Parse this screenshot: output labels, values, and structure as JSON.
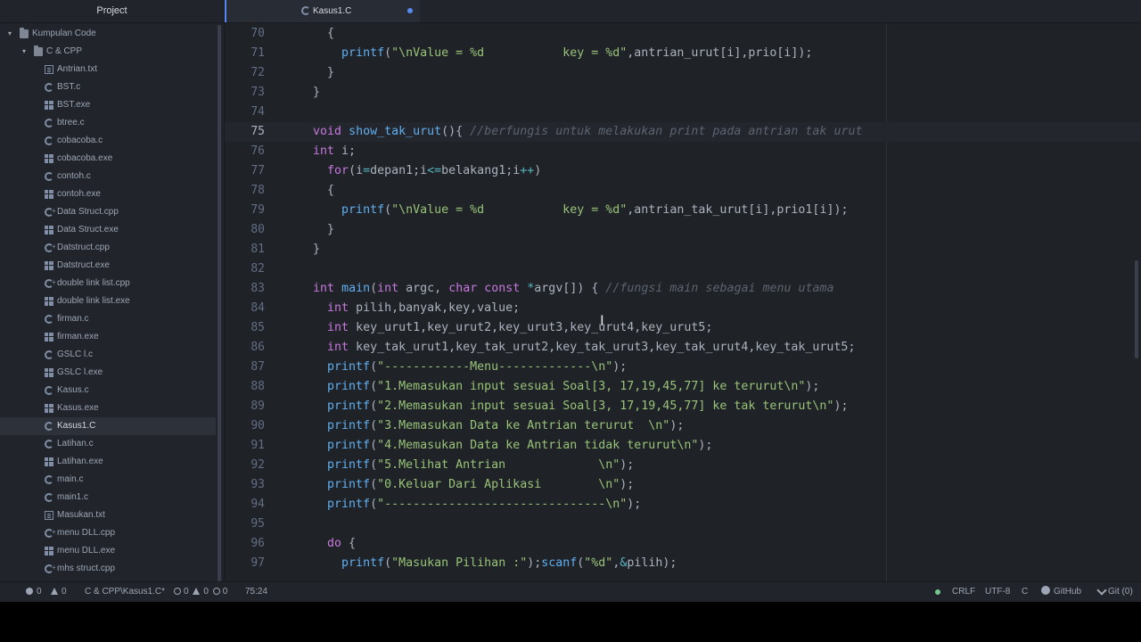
{
  "sidebar": {
    "title": "Project",
    "tree": [
      {
        "label": "Kumpulan Code",
        "icon": "folder-icon",
        "level": 0,
        "expanded": true
      },
      {
        "label": "C & CPP",
        "icon": "folder-icon",
        "level": 1,
        "expanded": true
      },
      {
        "label": "Antrian.txt",
        "icon": "text-file-icon",
        "level": 2
      },
      {
        "label": "BST.c",
        "icon": "c-file-icon",
        "level": 2
      },
      {
        "label": "BST.exe",
        "icon": "exe-file-icon",
        "level": 2
      },
      {
        "label": "btree.c",
        "icon": "c-file-icon",
        "level": 2
      },
      {
        "label": "cobacoba.c",
        "icon": "c-file-icon",
        "level": 2
      },
      {
        "label": "cobacoba.exe",
        "icon": "exe-file-icon",
        "level": 2
      },
      {
        "label": "contoh.c",
        "icon": "c-file-icon",
        "level": 2
      },
      {
        "label": "contoh.exe",
        "icon": "exe-file-icon",
        "level": 2
      },
      {
        "label": "Data Struct.cpp",
        "icon": "cpp-file-icon",
        "level": 2
      },
      {
        "label": "Data Struct.exe",
        "icon": "exe-file-icon",
        "level": 2
      },
      {
        "label": "Datstruct.cpp",
        "icon": "cpp-file-icon",
        "level": 2
      },
      {
        "label": "Datstruct.exe",
        "icon": "exe-file-icon",
        "level": 2
      },
      {
        "label": "double link list.cpp",
        "icon": "cpp-file-icon",
        "level": 2
      },
      {
        "label": "double link list.exe",
        "icon": "exe-file-icon",
        "level": 2
      },
      {
        "label": "firman.c",
        "icon": "c-file-icon",
        "level": 2
      },
      {
        "label": "firman.exe",
        "icon": "exe-file-icon",
        "level": 2
      },
      {
        "label": "GSLC l.c",
        "icon": "c-file-icon",
        "level": 2
      },
      {
        "label": "GSLC l.exe",
        "icon": "exe-file-icon",
        "level": 2
      },
      {
        "label": "Kasus.c",
        "icon": "c-file-icon",
        "level": 2
      },
      {
        "label": "Kasus.exe",
        "icon": "exe-file-icon",
        "level": 2
      },
      {
        "label": "Kasus1.C",
        "icon": "c-file-icon",
        "level": 2,
        "selected": true
      },
      {
        "label": "Latihan.c",
        "icon": "c-file-icon",
        "level": 2
      },
      {
        "label": "Latihan.exe",
        "icon": "exe-file-icon",
        "level": 2
      },
      {
        "label": "main.c",
        "icon": "c-file-icon",
        "level": 2
      },
      {
        "label": "main1.c",
        "icon": "c-file-icon",
        "level": 2
      },
      {
        "label": "Masukan.txt",
        "icon": "text-file-icon",
        "level": 2
      },
      {
        "label": "menu DLL.cpp",
        "icon": "cpp-file-icon",
        "level": 2
      },
      {
        "label": "menu DLL.exe",
        "icon": "exe-file-icon",
        "level": 2
      },
      {
        "label": "mhs struct.cpp",
        "icon": "cpp-file-icon",
        "level": 2
      }
    ]
  },
  "tab": {
    "title": "Kasus1.C",
    "icon": "c-file-icon",
    "modified": true
  },
  "editor": {
    "cursor_line": 75,
    "lines": [
      {
        "n": "70",
        "tokens": [
          [
            "    ",
            ""
          ],
          [
            "{",
            ""
          ]
        ]
      },
      {
        "n": "71",
        "tokens": [
          [
            "      ",
            ""
          ],
          [
            "printf",
            "fn"
          ],
          [
            "(",
            ""
          ],
          [
            "\"\\nValue = %d           key = %d\"",
            "str"
          ],
          [
            ",antrian_urut[i],prio[i]);",
            ""
          ]
        ]
      },
      {
        "n": "72",
        "tokens": [
          [
            "    ",
            ""
          ],
          [
            "}",
            ""
          ]
        ]
      },
      {
        "n": "73",
        "tokens": [
          [
            "  ",
            ""
          ],
          [
            "}",
            ""
          ]
        ]
      },
      {
        "n": "74",
        "tokens": []
      },
      {
        "n": "75",
        "tokens": [
          [
            "  ",
            ""
          ],
          [
            "void",
            "ty"
          ],
          [
            " ",
            ""
          ],
          [
            "show_tak_urut",
            "fn"
          ],
          [
            "(){ ",
            ""
          ],
          [
            "//berfungis untuk melakukan print pada antrian tak urut",
            "cmt"
          ]
        ]
      },
      {
        "n": "76",
        "tokens": [
          [
            "  ",
            ""
          ],
          [
            "int",
            "ty"
          ],
          [
            " i;",
            ""
          ]
        ]
      },
      {
        "n": "77",
        "tokens": [
          [
            "    ",
            ""
          ],
          [
            "for",
            "kw"
          ],
          [
            "(i",
            ""
          ],
          [
            "=",
            "op"
          ],
          [
            "depan1;i",
            ""
          ],
          [
            "<=",
            "op"
          ],
          [
            "belakang1;i",
            ""
          ],
          [
            "++",
            "op"
          ],
          [
            ")",
            ""
          ]
        ]
      },
      {
        "n": "78",
        "tokens": [
          [
            "    ",
            ""
          ],
          [
            "{",
            ""
          ]
        ]
      },
      {
        "n": "79",
        "tokens": [
          [
            "      ",
            ""
          ],
          [
            "printf",
            "fn"
          ],
          [
            "(",
            ""
          ],
          [
            "\"\\nValue = %d           key = %d\"",
            "str"
          ],
          [
            ",antrian_tak_urut[i],prio1[i]);",
            ""
          ]
        ]
      },
      {
        "n": "80",
        "tokens": [
          [
            "    ",
            ""
          ],
          [
            "}",
            ""
          ]
        ]
      },
      {
        "n": "81",
        "tokens": [
          [
            "  ",
            ""
          ],
          [
            "}",
            ""
          ]
        ]
      },
      {
        "n": "82",
        "tokens": []
      },
      {
        "n": "83",
        "tokens": [
          [
            "  ",
            ""
          ],
          [
            "int",
            "ty"
          ],
          [
            " ",
            ""
          ],
          [
            "main",
            "fn"
          ],
          [
            "(",
            ""
          ],
          [
            "int",
            "ty"
          ],
          [
            " argc, ",
            ""
          ],
          [
            "char",
            "ty"
          ],
          [
            " ",
            ""
          ],
          [
            "const",
            "kw"
          ],
          [
            " ",
            ""
          ],
          [
            "*",
            "op"
          ],
          [
            "argv[]) { ",
            ""
          ],
          [
            "//fungsi main sebagai menu utama",
            "cmt"
          ]
        ]
      },
      {
        "n": "84",
        "tokens": [
          [
            "    ",
            ""
          ],
          [
            "int",
            "ty"
          ],
          [
            " pilih,banyak,key,value;",
            ""
          ]
        ]
      },
      {
        "n": "85",
        "tokens": [
          [
            "    ",
            ""
          ],
          [
            "int",
            "ty"
          ],
          [
            " key_urut1,key_urut2,key_urut3,key_urut4,key_urut5;",
            ""
          ]
        ]
      },
      {
        "n": "86",
        "tokens": [
          [
            "    ",
            ""
          ],
          [
            "int",
            "ty"
          ],
          [
            " key_tak_urut1,key_tak_urut2,key_tak_urut3,key_tak_urut4,key_tak_urut5;",
            ""
          ]
        ]
      },
      {
        "n": "87",
        "tokens": [
          [
            "    ",
            ""
          ],
          [
            "printf",
            "fn"
          ],
          [
            "(",
            ""
          ],
          [
            "\"------------Menu-------------\\n\"",
            "str"
          ],
          [
            ");",
            ""
          ]
        ]
      },
      {
        "n": "88",
        "tokens": [
          [
            "    ",
            ""
          ],
          [
            "printf",
            "fn"
          ],
          [
            "(",
            ""
          ],
          [
            "\"1.Memasukan input sesuai Soal[3, 17,19,45,77] ke terurut\\n\"",
            "str"
          ],
          [
            ");",
            ""
          ]
        ]
      },
      {
        "n": "89",
        "tokens": [
          [
            "    ",
            ""
          ],
          [
            "printf",
            "fn"
          ],
          [
            "(",
            ""
          ],
          [
            "\"2.Memasukan input sesuai Soal[3, 17,19,45,77] ke tak terurut\\n\"",
            "str"
          ],
          [
            ");",
            ""
          ]
        ]
      },
      {
        "n": "90",
        "tokens": [
          [
            "    ",
            ""
          ],
          [
            "printf",
            "fn"
          ],
          [
            "(",
            ""
          ],
          [
            "\"3.Memasukan Data ke Antrian terurut  \\n\"",
            "str"
          ],
          [
            ");",
            ""
          ]
        ]
      },
      {
        "n": "91",
        "tokens": [
          [
            "    ",
            ""
          ],
          [
            "printf",
            "fn"
          ],
          [
            "(",
            ""
          ],
          [
            "\"4.Memasukan Data ke Antrian tidak terurut\\n\"",
            "str"
          ],
          [
            ");",
            ""
          ]
        ]
      },
      {
        "n": "92",
        "tokens": [
          [
            "    ",
            ""
          ],
          [
            "printf",
            "fn"
          ],
          [
            "(",
            ""
          ],
          [
            "\"5.Melihat Antrian             \\n\"",
            "str"
          ],
          [
            ");",
            ""
          ]
        ]
      },
      {
        "n": "93",
        "tokens": [
          [
            "    ",
            ""
          ],
          [
            "printf",
            "fn"
          ],
          [
            "(",
            ""
          ],
          [
            "\"0.Keluar Dari Aplikasi        \\n\"",
            "str"
          ],
          [
            ");",
            ""
          ]
        ]
      },
      {
        "n": "94",
        "tokens": [
          [
            "    ",
            ""
          ],
          [
            "printf",
            "fn"
          ],
          [
            "(",
            ""
          ],
          [
            "\"-------------------------------\\n\"",
            "str"
          ],
          [
            ");",
            ""
          ]
        ]
      },
      {
        "n": "95",
        "tokens": []
      },
      {
        "n": "96",
        "tokens": [
          [
            "    ",
            ""
          ],
          [
            "do",
            "kw"
          ],
          [
            " {",
            ""
          ]
        ]
      },
      {
        "n": "97",
        "tokens": [
          [
            "      ",
            ""
          ],
          [
            "printf",
            "fn"
          ],
          [
            "(",
            ""
          ],
          [
            "\"Masukan Pilihan :\"",
            "str"
          ],
          [
            ");",
            ""
          ],
          [
            "scanf",
            "fn"
          ],
          [
            "(",
            ""
          ],
          [
            "\"%d\"",
            "str"
          ],
          [
            ",",
            ""
          ],
          [
            "&",
            "op"
          ],
          [
            "pilih);",
            ""
          ]
        ]
      }
    ]
  },
  "statusbar": {
    "errors": "0",
    "warnings": "0",
    "file_path": "C & CPP\\Kasus1.C*",
    "lint_a": "0",
    "lint_b": "0",
    "lint_c": "0",
    "cursor_position": "75:24",
    "line_ending": "CRLF",
    "encoding": "UTF-8",
    "grammar": "C",
    "github_label": "GitHub",
    "git_label": "Git (0)"
  },
  "colors": {
    "accent": "#568af2",
    "background": "#1f2227",
    "sidebar": "#21252b",
    "string": "#98c379",
    "keyword": "#c678dd",
    "function": "#61afef",
    "comment": "#5c6370"
  }
}
